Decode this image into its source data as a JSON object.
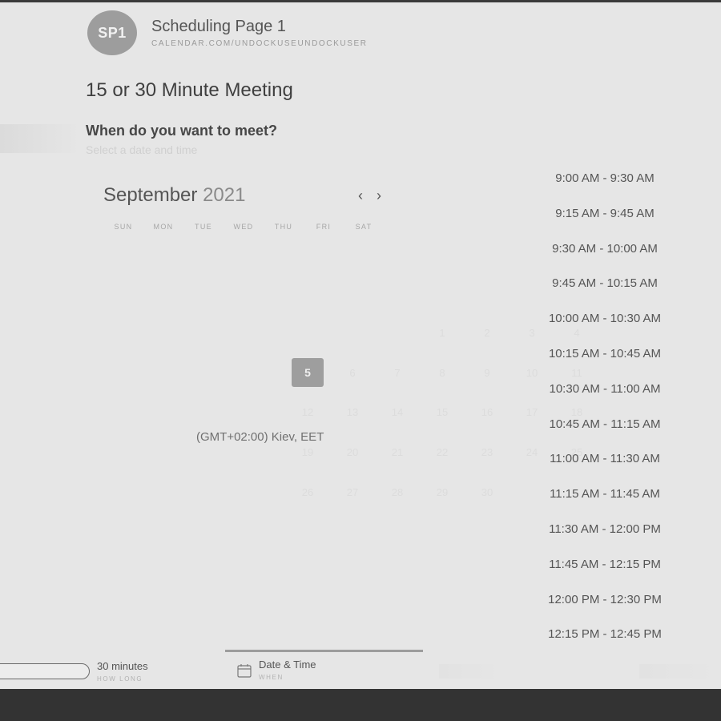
{
  "header": {
    "avatar_initials": "SP1",
    "page_name": "Scheduling Page 1",
    "page_url": "CALENDAR.COM/UNDOCKUSEUNDOCKUSER"
  },
  "event": {
    "title": "15 or 30 Minute Meeting",
    "question": "When do you want to meet?",
    "hint": "Select a date and time"
  },
  "calendar": {
    "month": "September",
    "year": "2021",
    "prev_icon": "‹",
    "next_icon": "›",
    "weekdays": [
      "SUN",
      "MON",
      "TUE",
      "WED",
      "THU",
      "FRI",
      "SAT"
    ],
    "weeks": [
      [
        "",
        "",
        "",
        "1",
        "2",
        "3",
        "4"
      ],
      [
        "5",
        "6",
        "7",
        "8",
        "9",
        "10",
        "11"
      ],
      [
        "12",
        "13",
        "14",
        "15",
        "16",
        "17",
        "18"
      ],
      [
        "19",
        "20",
        "21",
        "22",
        "23",
        "24",
        "25"
      ],
      [
        "26",
        "27",
        "28",
        "29",
        "30",
        "",
        ""
      ]
    ],
    "selected_day": "5"
  },
  "timezone": "(GMT+02:00) Kiev, EET",
  "time_slots": [
    "9:00 AM - 9:30 AM",
    "9:15 AM - 9:45 AM",
    "9:30 AM - 10:00 AM",
    "9:45 AM - 10:15 AM",
    "10:00 AM - 10:30 AM",
    "10:15 AM - 10:45 AM",
    "10:30 AM - 11:00 AM",
    "10:45 AM - 11:15 AM",
    "11:00 AM - 11:30 AM",
    "11:15 AM - 11:45 AM",
    "11:30 AM - 12:00 PM",
    "11:45 AM - 12:15 PM",
    "12:00 PM - 12:30 PM",
    "12:15 PM - 12:45 PM"
  ],
  "footer": {
    "duration_value": "30 minutes",
    "duration_caption": "HOW LONG",
    "datetime_value": "Date & Time",
    "datetime_caption": "WHEN"
  }
}
